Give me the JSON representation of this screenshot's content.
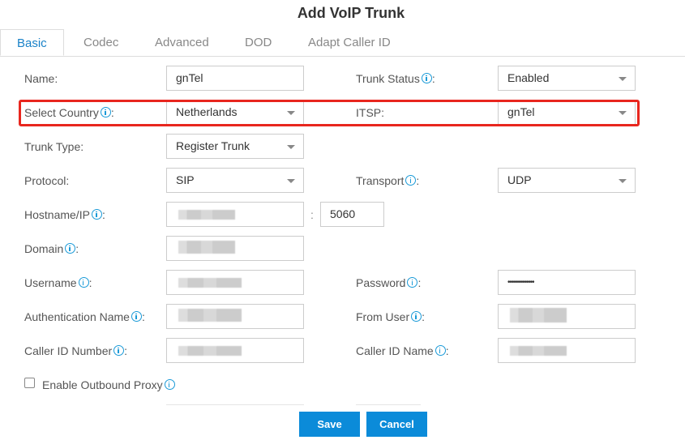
{
  "dialog": {
    "title": "Add VoIP Trunk"
  },
  "tabs": [
    {
      "label": "Basic",
      "active": true
    },
    {
      "label": "Codec"
    },
    {
      "label": "Advanced"
    },
    {
      "label": "DOD"
    },
    {
      "label": "Adapt Caller ID"
    }
  ],
  "form": {
    "name": {
      "label": "Name:",
      "value": "gnTel"
    },
    "trunk_status": {
      "label": "Trunk Status",
      "value": "Enabled"
    },
    "select_country": {
      "label": "Select Country",
      "value": "Netherlands"
    },
    "itsp": {
      "label": "ITSP:",
      "value": "gnTel"
    },
    "trunk_type": {
      "label": "Trunk Type:",
      "value": "Register Trunk"
    },
    "protocol": {
      "label": "Protocol:",
      "value": "SIP"
    },
    "transport": {
      "label": "Transport",
      "value": "UDP"
    },
    "hostname": {
      "label": "Hostname/IP",
      "value": "",
      "port_separator": ":",
      "port": "5060"
    },
    "domain": {
      "label": "Domain",
      "value": ""
    },
    "username": {
      "label": "Username",
      "value": ""
    },
    "password": {
      "label": "Password",
      "value": "•••••••••••••"
    },
    "auth_name": {
      "label": "Authentication Name",
      "value": ""
    },
    "from_user": {
      "label": "From User",
      "value": ""
    },
    "caller_id_number": {
      "label": "Caller ID Number",
      "value": ""
    },
    "caller_id_name": {
      "label": "Caller ID Name",
      "value": ""
    },
    "outbound_proxy": {
      "label": "Enable Outbound Proxy",
      "checked": false
    },
    "colon": ":"
  },
  "buttons": {
    "save": "Save",
    "cancel": "Cancel"
  },
  "colors": {
    "accent": "#0b8bd9",
    "highlight": "#e8261e",
    "info_icon": "#1a9ad8"
  }
}
